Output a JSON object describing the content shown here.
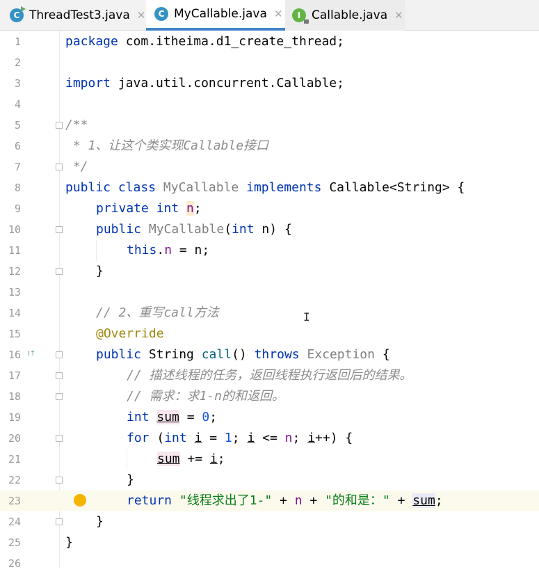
{
  "tabs": [
    {
      "label": "ThreadTest3.java",
      "icon": "c-class-run-icon"
    },
    {
      "label": "MyCallable.java",
      "icon": "c-class-icon",
      "active": true
    },
    {
      "label": "Callable.java",
      "icon": "i-interface-icon"
    }
  ],
  "icon_letters": {
    "class": "C",
    "interface": "I"
  },
  "close_glyph": "✕",
  "lines": [
    {
      "n": "1"
    },
    {
      "n": "2"
    },
    {
      "n": "3"
    },
    {
      "n": "4"
    },
    {
      "n": "5"
    },
    {
      "n": "6"
    },
    {
      "n": "7"
    },
    {
      "n": "8"
    },
    {
      "n": "9"
    },
    {
      "n": "10"
    },
    {
      "n": "11"
    },
    {
      "n": "12"
    },
    {
      "n": "13"
    },
    {
      "n": "14"
    },
    {
      "n": "15"
    },
    {
      "n": "16"
    },
    {
      "n": "17"
    },
    {
      "n": "18"
    },
    {
      "n": "19"
    },
    {
      "n": "20"
    },
    {
      "n": "21"
    },
    {
      "n": "22"
    },
    {
      "n": "23"
    },
    {
      "n": "24"
    },
    {
      "n": "25"
    },
    {
      "n": "26"
    }
  ],
  "code": {
    "l1_kw": "package",
    "l1_rest": " com.itheima.d1_create_thread;",
    "l3_kw": "import",
    "l3_rest": " java.util.concurrent.Callable;",
    "l5": "/**",
    "l6": " * 1、让这个类实现Callable接口",
    "l7": " */",
    "l8_kw1": "public class ",
    "l8_name": "MyCallable",
    "l8_kw2": " implements ",
    "l8_rest": "Callable<String> {",
    "l9_kw": "private int ",
    "l9_field": "n",
    "l9_end": ";",
    "l10_kw": "public ",
    "l10_name": "MyCallable",
    "l10_p1": "(",
    "l10_kw2": "int",
    "l10_p2": " n) {",
    "l11_kw": "this",
    "l11_dot": ".",
    "l11_field": "n",
    "l11_rest": " = n;",
    "l12": "}",
    "l14": "// 2、重写call方法",
    "l15": "@Override",
    "l16_kw": "public ",
    "l16_type": "String ",
    "l16_m": "call",
    "l16_p": "() ",
    "l16_kw2": "throws ",
    "l16_ex": "Exception",
    "l16_end": " {",
    "l17": "// 描述线程的任务，返回线程执行返回后的结果。",
    "l18": "// 需求：求1-n的和返回。",
    "l19_kw": "int ",
    "l19_var": "sum",
    "l19_eq": " = ",
    "l19_num": "0",
    "l19_end": ";",
    "l20_kw": "for ",
    "l20_p": "(",
    "l20_kw2": "int ",
    "l20_i": "i",
    "l20_eq": " = ",
    "l20_num": "1",
    "l20_s": "; ",
    "l20_i2": "i",
    "l20_le": " <= ",
    "l20_n": "n",
    "l20_s2": "; ",
    "l20_i3": "i",
    "l20_end": "++) {",
    "l21_var": "sum",
    "l21_op": " += ",
    "l21_i": "i",
    "l21_end": ";",
    "l22": "}",
    "l23_kw": "return ",
    "l23_s1": "\"线程求出了1-\"",
    "l23_p1": " + ",
    "l23_n": "n",
    "l23_p2": " + ",
    "l23_s2": "\"的和是：\"",
    "l23_p3": " + ",
    "l23_sum": "sum",
    "l23_end": ";",
    "l24": "}",
    "l25": "}"
  },
  "gutter_marker_text": "I↑",
  "cursor_glyph": "I"
}
